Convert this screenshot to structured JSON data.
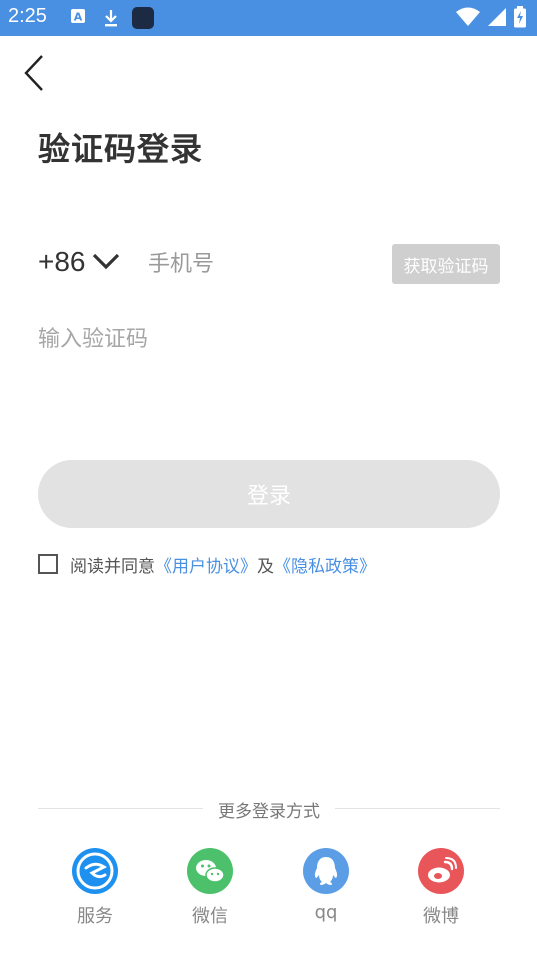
{
  "status_bar": {
    "time": "2:25",
    "icons": [
      "a-icon",
      "download-icon",
      "app-icon",
      "wifi-icon",
      "signal-icon",
      "battery-icon"
    ]
  },
  "page": {
    "title": "验证码登录"
  },
  "phone": {
    "country_code": "+86",
    "placeholder": "手机号",
    "get_code_label": "获取验证码"
  },
  "code": {
    "placeholder": "输入验证码"
  },
  "login": {
    "label": "登录"
  },
  "agreement": {
    "prefix": "阅读并同意",
    "user_agreement": "《用户协议》",
    "conjunction": "及",
    "privacy_policy": "《隐私政策》"
  },
  "more_login": {
    "title": "更多登录方式",
    "methods": [
      {
        "label": "服务",
        "icon": "service-icon",
        "color": "#1e90f0"
      },
      {
        "label": "微信",
        "icon": "wechat-icon",
        "color": "#4cc06a"
      },
      {
        "label": "qq",
        "icon": "qq-icon",
        "color": "#5b9ee6"
      },
      {
        "label": "微博",
        "icon": "weibo-icon",
        "color": "#e8565a"
      }
    ]
  },
  "colors": {
    "status_bar": "#4a90e2",
    "link": "#4a90e2",
    "button_disabled": "#e2e2e2",
    "code_button": "#cfcfcf"
  }
}
